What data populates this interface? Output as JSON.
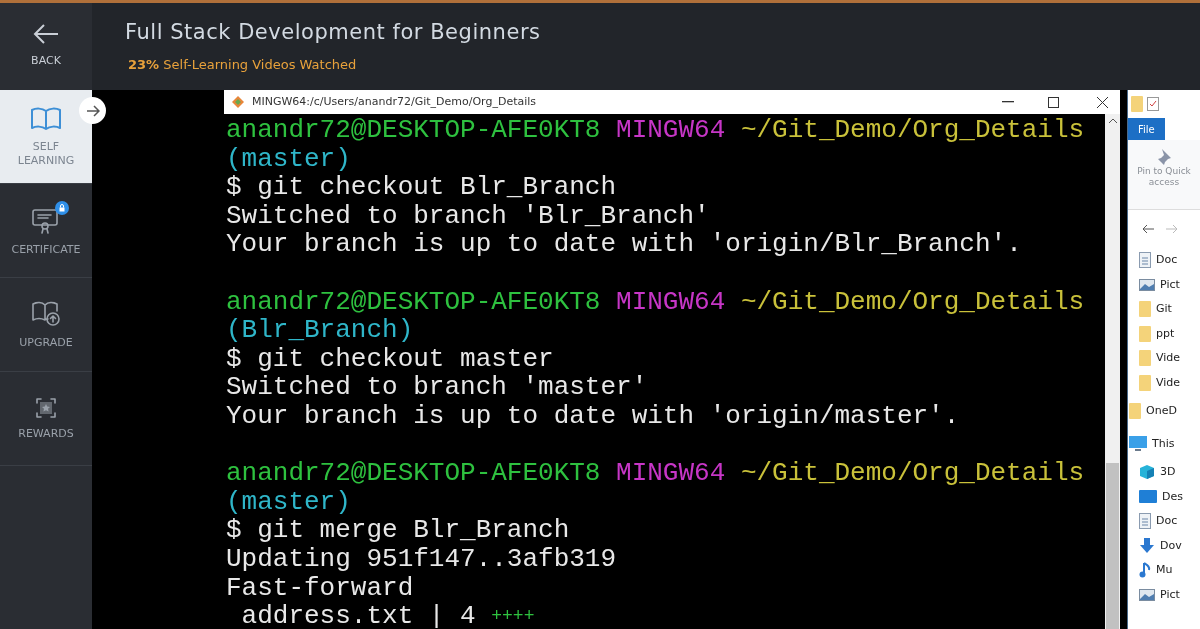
{
  "back": {
    "label": "BACK"
  },
  "sidebar": {
    "items": [
      {
        "label": "SELF LEARNING",
        "kind": "book",
        "selected": true,
        "locked": false
      },
      {
        "label": "CERTIFICATE",
        "kind": "certificate",
        "selected": false,
        "locked": true
      },
      {
        "label": "UPGRADE",
        "kind": "upgrade",
        "selected": false,
        "locked": false
      },
      {
        "label": "REWARDS",
        "kind": "rewards",
        "selected": false,
        "locked": false
      }
    ]
  },
  "header": {
    "title": "Full Stack Development for Beginners",
    "progress_value": "23%",
    "progress_label": "Self-Learning Videos Watched"
  },
  "terminal": {
    "title": "MINGW64:/c/Users/anandr72/Git_Demo/Org_Details",
    "lines": [
      {
        "segments": [
          {
            "text": "anandr72@DESKTOP-AFE0KT8",
            "kind": "user"
          },
          {
            "text": "MINGW64",
            "kind": "shell"
          },
          {
            "text": "~/Git_Demo/Org_Details",
            "kind": "path"
          }
        ]
      },
      {
        "segments": [
          {
            "text": "(master)",
            "kind": "branch"
          }
        ]
      },
      {
        "segments": [
          {
            "text": "$ git checkout Blr_Branch",
            "kind": "plain"
          }
        ]
      },
      {
        "segments": [
          {
            "text": "Switched to branch 'Blr_Branch'",
            "kind": "plain"
          }
        ]
      },
      {
        "segments": [
          {
            "text": "Your branch is up to date with 'origin/Blr_Branch'.",
            "kind": "plain"
          }
        ]
      },
      {
        "kind": "blank"
      },
      {
        "segments": [
          {
            "text": "anandr72@DESKTOP-AFE0KT8",
            "kind": "user"
          },
          {
            "text": "MINGW64",
            "kind": "shell"
          },
          {
            "text": "~/Git_Demo/Org_Details",
            "kind": "path"
          }
        ]
      },
      {
        "segments": [
          {
            "text": "(Blr_Branch)",
            "kind": "branch"
          }
        ]
      },
      {
        "segments": [
          {
            "text": "$ git checkout master",
            "kind": "plain"
          }
        ]
      },
      {
        "segments": [
          {
            "text": "Switched to branch 'master'",
            "kind": "plain"
          }
        ]
      },
      {
        "segments": [
          {
            "text": "Your branch is up to date with 'origin/master'.",
            "kind": "plain"
          }
        ]
      },
      {
        "kind": "blank"
      },
      {
        "segments": [
          {
            "text": "anandr72@DESKTOP-AFE0KT8",
            "kind": "user"
          },
          {
            "text": "MINGW64",
            "kind": "shell"
          },
          {
            "text": "~/Git_Demo/Org_Details",
            "kind": "path"
          }
        ]
      },
      {
        "segments": [
          {
            "text": "(master)",
            "kind": "branch"
          }
        ]
      },
      {
        "segments": [
          {
            "text": "$ git merge Blr_Branch",
            "kind": "plain"
          }
        ]
      },
      {
        "segments": [
          {
            "text": "Updating 951f147..3afb319",
            "kind": "plain"
          }
        ]
      },
      {
        "segments": [
          {
            "text": "Fast-forward",
            "kind": "plain"
          }
        ]
      },
      {
        "segments": [
          {
            "text": " address.txt | 4",
            "kind": "plain"
          },
          {
            "text": "++++",
            "kind": "plus"
          }
        ]
      }
    ]
  },
  "explorer": {
    "tab": "File",
    "ribbon_action": "Pin to Quick access",
    "items": [
      {
        "label": "Doc",
        "kind": "doc",
        "group": false
      },
      {
        "label": "Pict",
        "kind": "image",
        "group": false
      },
      {
        "label": "Git",
        "kind": "folder",
        "group": false
      },
      {
        "label": "ppt",
        "kind": "folder",
        "group": false
      },
      {
        "label": "Vide",
        "kind": "folder",
        "group": false
      },
      {
        "label": "Vide",
        "kind": "folder",
        "group": false
      },
      {
        "label": "OneD",
        "kind": "folder",
        "group": true
      },
      {
        "label": "This",
        "kind": "pc",
        "group": true
      },
      {
        "label": "3D",
        "kind": "cube",
        "group": false
      },
      {
        "label": "Des",
        "kind": "desktop",
        "group": false
      },
      {
        "label": "Doc",
        "kind": "doc",
        "group": false
      },
      {
        "label": "Dov",
        "kind": "download",
        "group": false
      },
      {
        "label": "Mu",
        "kind": "music",
        "group": false
      },
      {
        "label": "Pict",
        "kind": "image",
        "group": false
      }
    ]
  }
}
